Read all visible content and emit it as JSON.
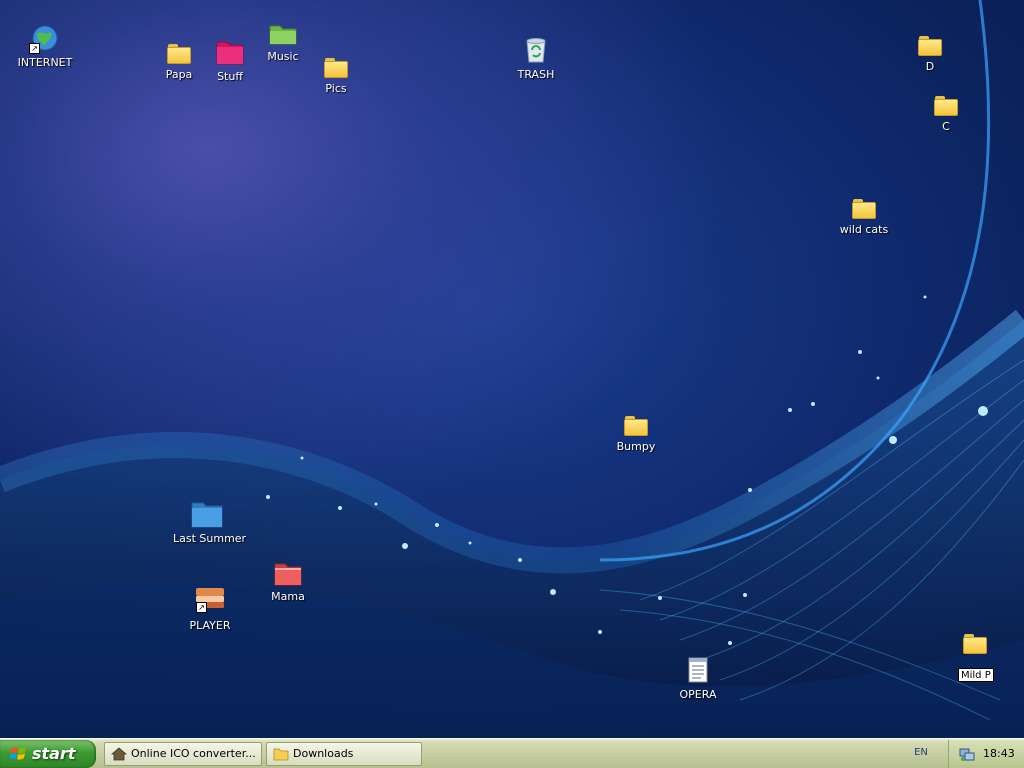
{
  "desktop": {
    "icons": {
      "internet": "INTERNET",
      "papa": "Papa",
      "stuff": "Stuff",
      "music": "Music",
      "pics": "Pics",
      "trash": "TRASH",
      "d": "D",
      "c": "C",
      "wild_cats": "wild cats",
      "bumpy": "Bumpy",
      "last_summer": "Last Summer",
      "mama": "Mama",
      "player": "PLAYER",
      "opera": "OPERA"
    },
    "rename_value": "Mild P"
  },
  "taskbar": {
    "start_label": "start",
    "tasks": [
      {
        "label": "Online ICO converter..."
      },
      {
        "label": "Downloads"
      }
    ],
    "language": "EN",
    "clock": "18:43"
  },
  "colors": {
    "taskbar": "#c6cea3",
    "start": "#3d9a33",
    "desktop": "#0f2a6e"
  }
}
